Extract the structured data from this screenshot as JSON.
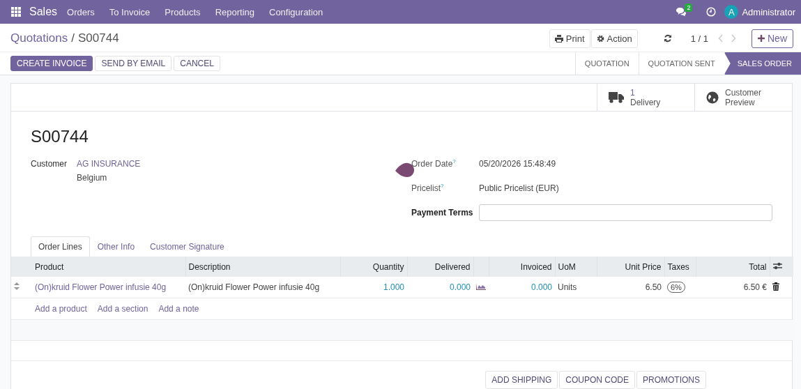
{
  "navbar": {
    "app": "Sales",
    "menu": [
      "Orders",
      "To Invoice",
      "Products",
      "Reporting",
      "Configuration"
    ],
    "messages_count": "2",
    "user_initial": "A",
    "user_name": "Administrator"
  },
  "breadcrumb": {
    "parent": "Quotations",
    "separator": "/",
    "current": "S00744"
  },
  "actions": {
    "print": "Print",
    "action": "Action",
    "pager": "1 / 1",
    "new": "New"
  },
  "buttons": [
    {
      "label": "CREATE INVOICE",
      "primary": true
    },
    {
      "label": "SEND BY EMAIL",
      "primary": false
    },
    {
      "label": "CANCEL",
      "primary": false
    }
  ],
  "statusbar": [
    {
      "label": "QUOTATION",
      "selected": false
    },
    {
      "label": "QUOTATION SENT",
      "selected": false
    },
    {
      "label": "SALES ORDER",
      "selected": true
    }
  ],
  "smart_buttons": [
    {
      "kind": "delivery",
      "value": "1",
      "label": "Delivery"
    },
    {
      "kind": "preview",
      "value": "Customer",
      "label": "Preview"
    }
  ],
  "record": {
    "name": "S00744",
    "customer_label": "Customer",
    "customer": "AG INSURANCE",
    "customer_country": "Belgium",
    "order_date_label": "Order Date",
    "help_mark": "?",
    "order_date": "05/20/2026 15:48:49",
    "pricelist_label": "Pricelist",
    "pricelist": "Public Pricelist (EUR)",
    "payment_terms_label": "Payment Terms"
  },
  "tabs": [
    {
      "label": "Order Lines",
      "selected": true
    },
    {
      "label": "Other Info",
      "selected": false
    },
    {
      "label": "Customer Signature",
      "selected": false
    }
  ],
  "table": {
    "columns": [
      "Product",
      "Description",
      "Quantity",
      "Delivered",
      "Invoiced",
      "UoM",
      "Unit Price",
      "Taxes",
      "Total"
    ],
    "rows": [
      {
        "product": "(On)kruid Flower Power infusie 40g",
        "description": "(On)kruid Flower Power infusie 40g",
        "quantity": "1.000",
        "delivered": "0.000",
        "invoiced": "0.000",
        "uom": "Units",
        "unit_price": "6.50",
        "taxes": "6%",
        "total": "6.50 €"
      }
    ],
    "add_links": [
      "Add a product",
      "Add a section",
      "Add a note"
    ]
  },
  "footer_buttons": [
    "ADD SHIPPING",
    "COUPON CODE",
    "PROMOTIONS"
  ]
}
